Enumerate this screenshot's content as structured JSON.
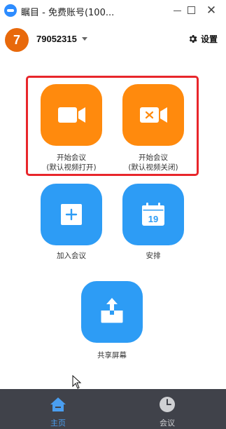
{
  "window": {
    "title": "瞩目 - 免费账号(100...",
    "minimize_icon": "minimize-icon",
    "maximize_icon": "maximize-icon",
    "close_label": "✕"
  },
  "header": {
    "avatar_letter": "7",
    "user_id": "79052315",
    "settings_label": "设置"
  },
  "actions": {
    "start_video_on": {
      "line1": "开始会议",
      "line2": "(默认视频打开)",
      "icon": "video-camera-icon"
    },
    "start_video_off": {
      "line1": "开始会议",
      "line2": "(默认视频关闭)",
      "icon": "video-off-icon"
    },
    "join": {
      "label": "加入会议",
      "icon": "plus-icon"
    },
    "schedule": {
      "label": "安排",
      "icon": "calendar-icon",
      "calendar_day": "19"
    },
    "share": {
      "label": "共享屏幕",
      "icon": "share-upload-icon"
    }
  },
  "nav": {
    "home_label": "主页",
    "meetings_label": "会议"
  },
  "colors": {
    "orange": "#ff8a0d",
    "blue": "#2d9cf5",
    "avatar": "#e8690b",
    "highlight": "#e8262b",
    "nav_bg": "#40424a",
    "nav_active": "#4a9ef0"
  }
}
